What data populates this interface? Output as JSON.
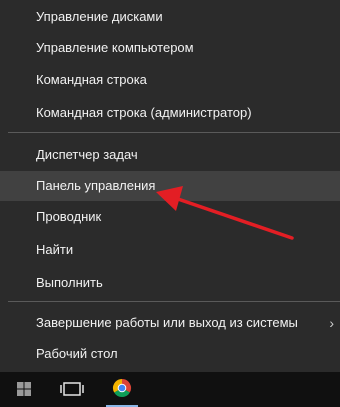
{
  "context_menu": {
    "items": [
      {
        "label": "Управление дисками"
      },
      {
        "label": "Управление компьютером"
      },
      {
        "label": "Командная строка"
      },
      {
        "label": "Командная строка (администратор)"
      },
      {
        "label": "Диспетчер задач"
      },
      {
        "label": "Панель управления",
        "highlighted": true
      },
      {
        "label": "Проводник"
      },
      {
        "label": "Найти"
      },
      {
        "label": "Выполнить"
      },
      {
        "label": "Завершение работы или выход из системы",
        "has_submenu": true
      },
      {
        "label": "Рабочий стол"
      }
    ],
    "submenu_arrow": "›"
  },
  "taskbar": {
    "icons": [
      "windows-start-icon",
      "task-view-icon",
      "chrome-icon"
    ]
  },
  "annotation": {
    "type": "red-arrow",
    "color": "#e31e24",
    "points_to": "Панель управления"
  },
  "colors": {
    "menu_bg": "#2b2b2b",
    "menu_text": "#f2f2f2",
    "hover_bg": "#414141",
    "taskbar_bg": "#101010"
  }
}
